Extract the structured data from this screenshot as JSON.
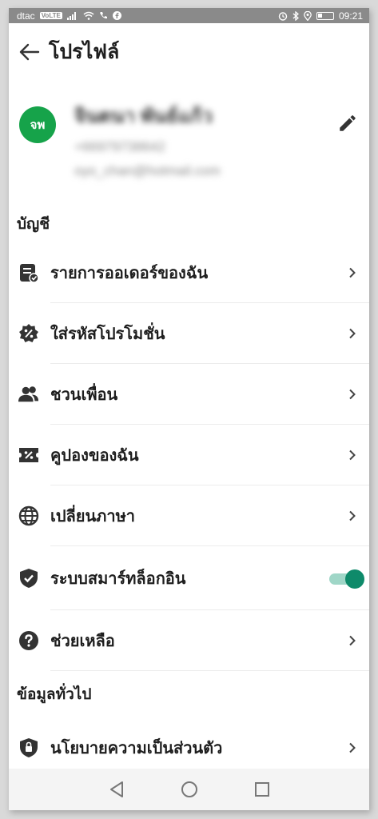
{
  "status_bar": {
    "carrier": "dtac",
    "network": "VoLTE",
    "time": "09:21"
  },
  "header": {
    "title": "โปรไฟล์"
  },
  "profile": {
    "avatar_initials": "จพ",
    "avatar_color": "#16a34a",
    "name": "จินตนา พันธ์แก้ว",
    "phone": "+66979738642",
    "email": "oyo_chan@hotmail.com"
  },
  "sections": {
    "account": "บัญชี",
    "general": "ข้อมูลทั่วไป"
  },
  "menu": [
    {
      "label": "รายการออเดอร์ของฉัน",
      "icon": "order-list-icon"
    },
    {
      "label": "ใส่รหัสโปรโมชั่น",
      "icon": "promo-badge-icon"
    },
    {
      "label": "ชวนเพื่อน",
      "icon": "invite-friends-icon"
    },
    {
      "label": "คูปองของฉัน",
      "icon": "coupon-icon"
    },
    {
      "label": "เปลี่ยนภาษา",
      "icon": "globe-icon"
    },
    {
      "label": "ระบบสมาร์ทล็อกอิน",
      "icon": "shield-icon",
      "toggle": true
    },
    {
      "label": "ช่วยเหลือ",
      "icon": "help-icon"
    }
  ],
  "general_menu": [
    {
      "label": "นโยบายความเป็นส่วนตัว",
      "icon": "privacy-icon"
    }
  ],
  "colors": {
    "toggle_on": "#0e8a6a",
    "icon": "#333333"
  }
}
